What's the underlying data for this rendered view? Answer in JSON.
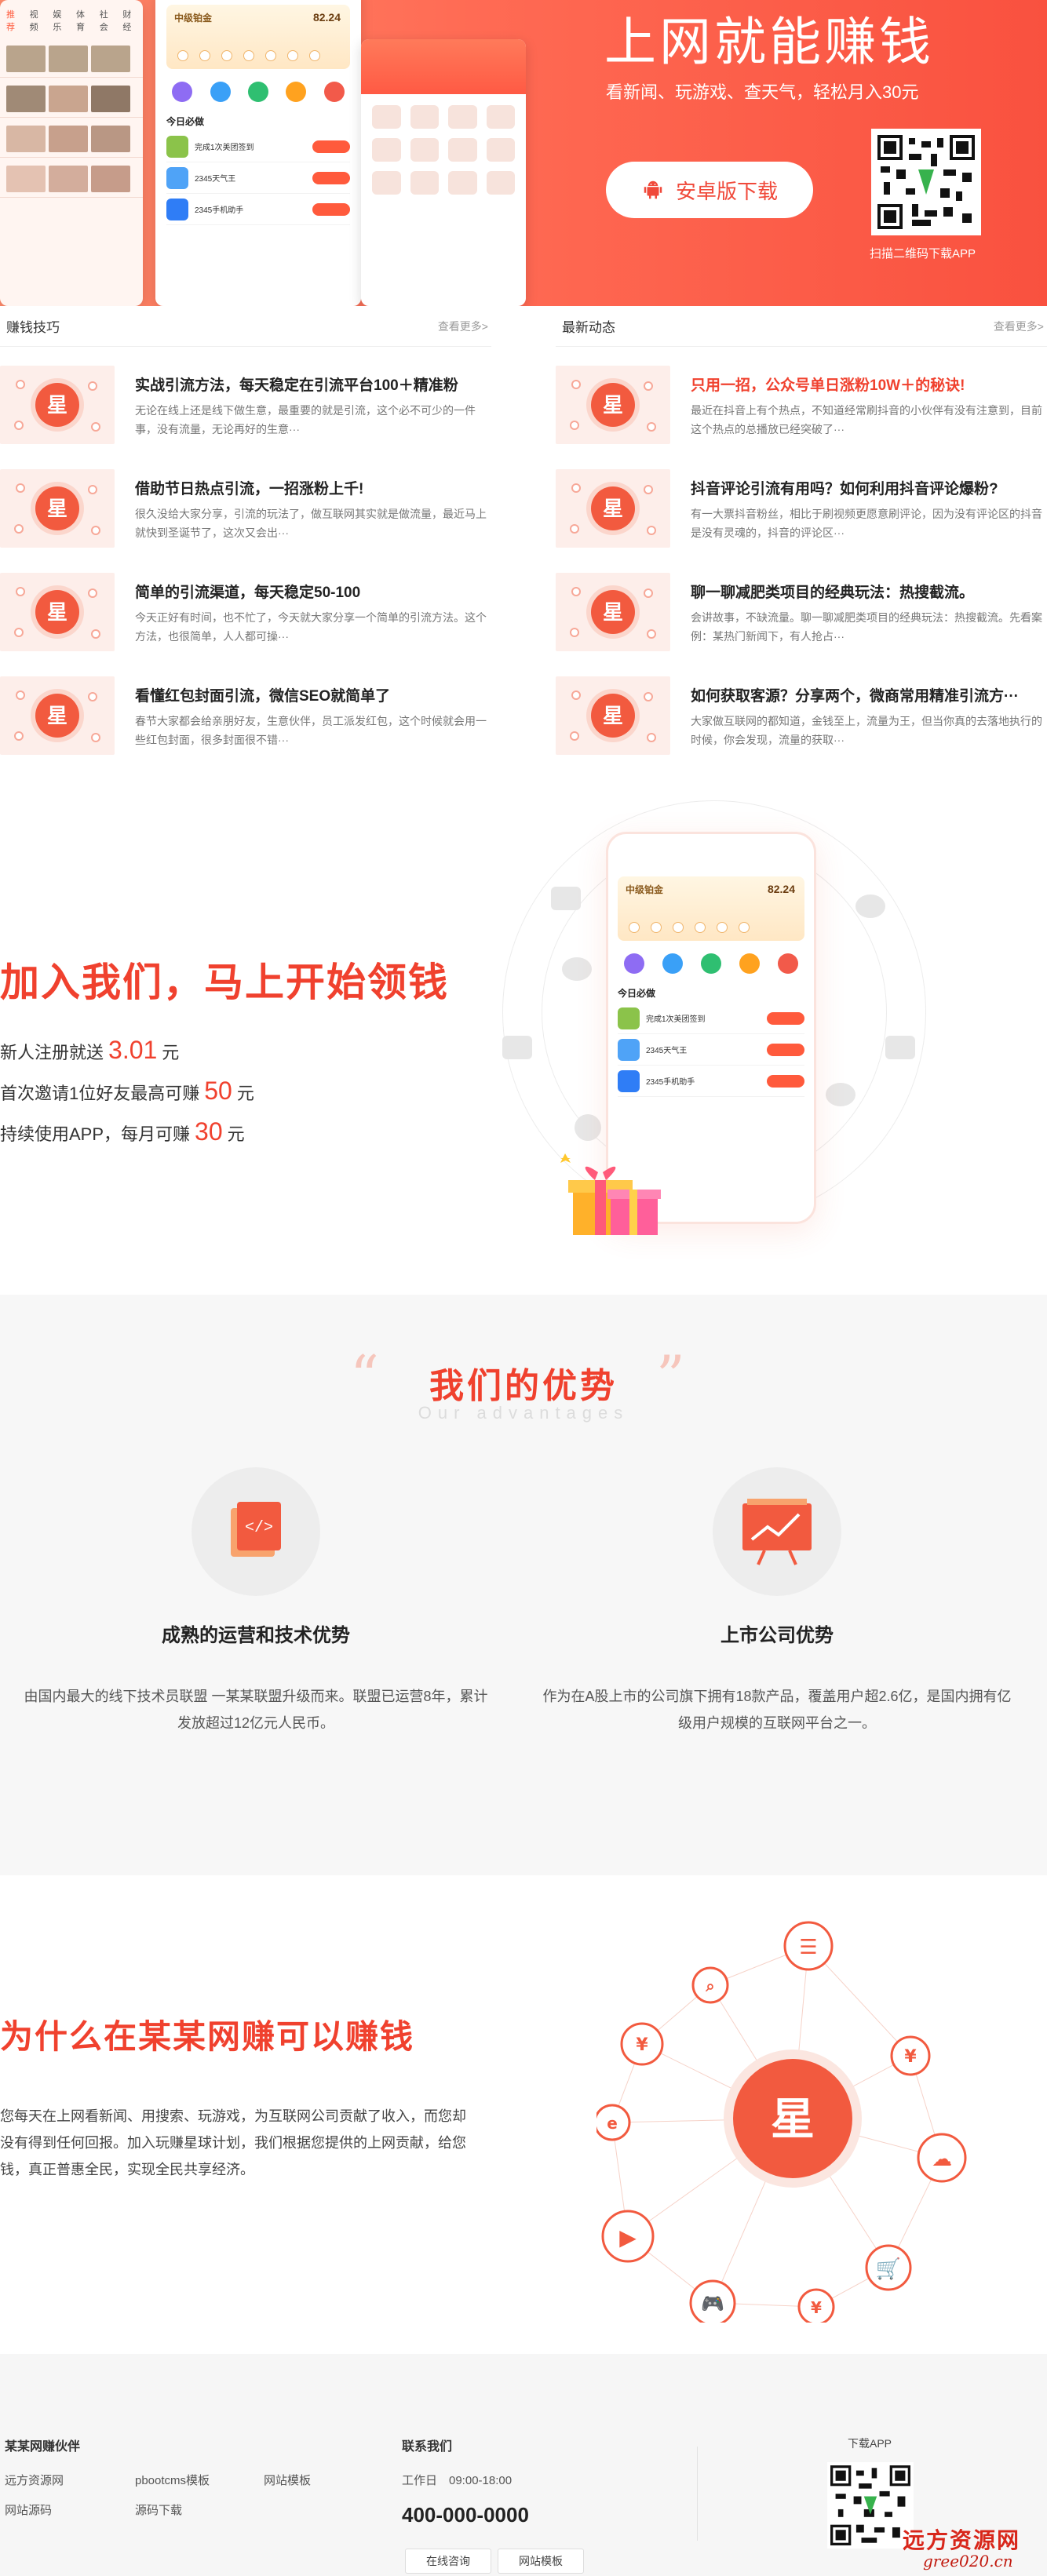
{
  "hero": {
    "title": "上网就能赚钱",
    "subtitle": "看新闻、玩游戏、查天气，轻松月入30元",
    "download_button": "安卓版下载",
    "qr_caption": "扫描二维码下载APP",
    "phone": {
      "tabs": [
        "推荐",
        "视频",
        "娱乐",
        "体育",
        "社会",
        "财经"
      ],
      "level_label": "中级铂金",
      "balance": "82.24",
      "today_must": "今日必做",
      "tasks": [
        "完成1次美团签到",
        "2345天气王",
        "2345手机助手"
      ]
    }
  },
  "articles": {
    "left": {
      "heading": "赚钱技巧",
      "more": "查看更多>",
      "items": [
        {
          "title": "实战引流方法，每天稳定在引流平台100＋精准粉",
          "desc": "无论在线上还是线下做生意，最重要的就是引流，这个必不可少的一件事，没有流量，无论再好的生意···"
        },
        {
          "title": "借助节日热点引流，一招涨粉上千!",
          "desc": "很久没给大家分享，引流的玩法了，做互联网其实就是做流量，最近马上就快到圣诞节了，这次又会出···"
        },
        {
          "title": "简单的引流渠道，每天稳定50-100",
          "desc": "今天正好有时间，也不忙了，今天就大家分享一个简单的引流方法。这个方法，也很简单，人人都可操···"
        },
        {
          "title": "看懂红包封面引流，微信SEO就简单了",
          "desc": "春节大家都会给亲朋好友，生意伙伴，员工派发红包，这个时候就会用一些红包封面，很多封面很不错···"
        }
      ]
    },
    "right": {
      "heading": "最新动态",
      "more": "查看更多>",
      "items": [
        {
          "title": "只用一招，公众号单日涨粉10W＋的秘诀!",
          "desc": "最近在抖音上有个热点，不知道经常刷抖音的小伙伴有没有注意到，目前这个热点的总播放已经突破了···"
        },
        {
          "title": "抖音评论引流有用吗？如何利用抖音评论爆粉?",
          "desc": "有一大票抖音粉丝，相比于刷视频更愿意刷评论，因为没有评论区的抖音是没有灵魂的，抖音的评论区···"
        },
        {
          "title": "聊一聊减肥类项目的经典玩法：热搜截流。",
          "desc": "会讲故事，不缺流量。聊一聊减肥类项目的经典玩法：热搜截流。先看案例：某热门新闻下，有人抢占···"
        },
        {
          "title": "如何获取客源？分享两个，微商常用精准引流方···",
          "desc": "大家做互联网的都知道，金钱至上，流量为王，但当你真的去落地执行的时候，你会发现，流量的获取···"
        }
      ]
    }
  },
  "join": {
    "title": "加入我们，马上开始领钱",
    "lines": [
      {
        "pre": "新人注册就送",
        "value": "3.01",
        "post": "元"
      },
      {
        "pre": "首次邀请1位好友最高可赚",
        "value": "50",
        "post": "元"
      },
      {
        "pre": "持续使用APP，每月可赚",
        "value": "30",
        "post": "元"
      }
    ]
  },
  "advantages": {
    "title": "我们的优势",
    "subtitle_en": "Our advantages",
    "items": [
      {
        "icon": "code-icon",
        "title": "成熟的运营和技术优势",
        "desc": "由国内最大的线下技术员联盟 一某某联盟升级而来。联盟已运营8年，累计发放超过12亿元人民币。"
      },
      {
        "icon": "chart-board-icon",
        "title": "上市公司优势",
        "desc": "作为在A股上市的公司旗下拥有18款产品，覆盖用户超2.6亿，是国内拥有亿级用户规模的互联网平台之一。"
      }
    ]
  },
  "why": {
    "title": "为什么在某某网赚可以赚钱",
    "desc": "您每天在上网看新闻、用搜索、玩游戏，为互联网公司贡献了收入，而您却没有得到任何回报。加入玩赚星球计划，我们根据您提供的上网贡献，给您钱，真正普惠全民，实现全民共享经济。"
  },
  "footer": {
    "partners_heading": "某某网赚伙伴",
    "links": [
      "远方资源网",
      "pbootcms模板",
      "网站模板",
      "网站源码",
      "源码下载"
    ],
    "contact_heading": "联系我们",
    "hours": "工作日　09:00-18:00",
    "phone": "400-000-0000",
    "buttons": [
      "在线咨询",
      "网站模板"
    ],
    "download_label": "下载APP",
    "watermark": "远方资源网",
    "watermark_url": "gree020.cn"
  },
  "colors": {
    "accent": "#f0412e",
    "hero_start": "#ff8a6b",
    "hero_end": "#f9513f"
  }
}
